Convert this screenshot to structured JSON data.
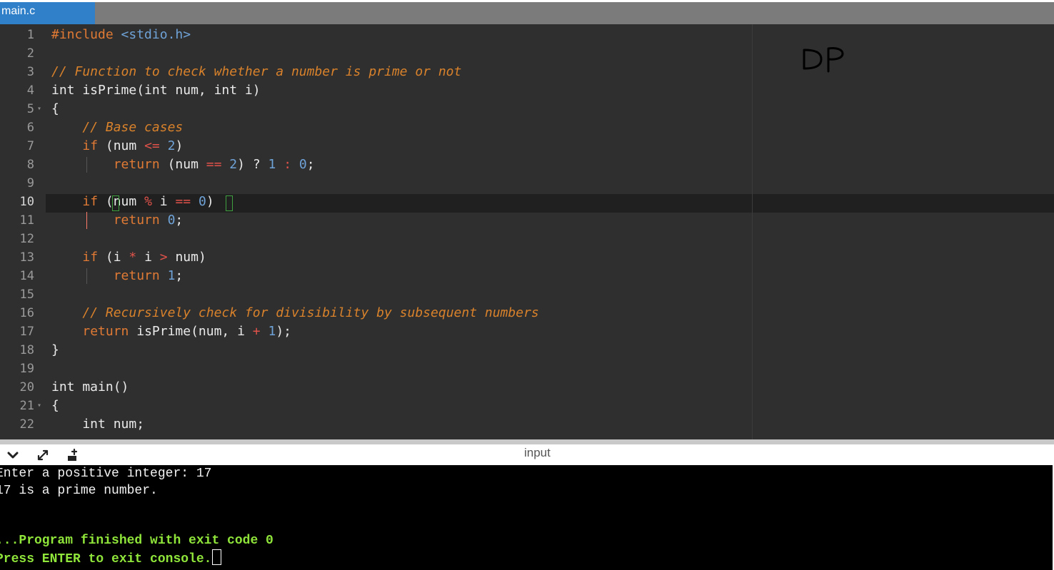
{
  "tab": {
    "title": "main.c"
  },
  "editor": {
    "lines": [
      {
        "num": "1",
        "tokens": [
          {
            "c": "kw",
            "t": "#include "
          },
          {
            "c": "inc",
            "t": "<stdio.h>"
          }
        ]
      },
      {
        "num": "2",
        "tokens": []
      },
      {
        "num": "3",
        "tokens": [
          {
            "c": "cm",
            "t": "// Function to check whether a number is prime or not"
          }
        ]
      },
      {
        "num": "4",
        "tokens": [
          {
            "c": "txt",
            "t": "int isPrime(int num, int i)"
          }
        ]
      },
      {
        "num": "5",
        "fold": true,
        "tokens": [
          {
            "c": "txt",
            "t": "{"
          }
        ]
      },
      {
        "num": "6",
        "tokens": [
          {
            "c": "txt",
            "t": "    "
          },
          {
            "c": "cm",
            "t": "// Base cases"
          }
        ]
      },
      {
        "num": "7",
        "tokens": [
          {
            "c": "txt",
            "t": "    "
          },
          {
            "c": "kw",
            "t": "if"
          },
          {
            "c": "txt",
            "t": " (num "
          },
          {
            "c": "op",
            "t": "<="
          },
          {
            "c": "txt",
            "t": " "
          },
          {
            "c": "num",
            "t": "2"
          },
          {
            "c": "txt",
            "t": ")"
          }
        ]
      },
      {
        "num": "8",
        "guide": true,
        "tokens": [
          {
            "c": "txt",
            "t": "        "
          },
          {
            "c": "kw",
            "t": "return"
          },
          {
            "c": "txt",
            "t": " (num "
          },
          {
            "c": "op",
            "t": "=="
          },
          {
            "c": "txt",
            "t": " "
          },
          {
            "c": "num",
            "t": "2"
          },
          {
            "c": "txt",
            "t": ") ? "
          },
          {
            "c": "num",
            "t": "1"
          },
          {
            "c": "txt",
            "t": " "
          },
          {
            "c": "op",
            "t": ":"
          },
          {
            "c": "txt",
            "t": " "
          },
          {
            "c": "num",
            "t": "0"
          },
          {
            "c": "txt",
            "t": ";"
          }
        ]
      },
      {
        "num": "9",
        "tokens": []
      },
      {
        "num": "10",
        "active": true,
        "tokens": [
          {
            "c": "txt",
            "t": "    "
          },
          {
            "c": "kw",
            "t": "if"
          },
          {
            "c": "txt",
            "t": " (num "
          },
          {
            "c": "op",
            "t": "%"
          },
          {
            "c": "txt",
            "t": " i "
          },
          {
            "c": "op",
            "t": "=="
          },
          {
            "c": "txt",
            "t": " "
          },
          {
            "c": "num",
            "t": "0"
          },
          {
            "c": "txt",
            "t": ")"
          }
        ]
      },
      {
        "num": "11",
        "cursor": true,
        "tokens": [
          {
            "c": "txt",
            "t": "        "
          },
          {
            "c": "kw",
            "t": "return"
          },
          {
            "c": "txt",
            "t": " "
          },
          {
            "c": "num",
            "t": "0"
          },
          {
            "c": "txt",
            "t": ";"
          }
        ]
      },
      {
        "num": "12",
        "tokens": []
      },
      {
        "num": "13",
        "tokens": [
          {
            "c": "txt",
            "t": "    "
          },
          {
            "c": "kw",
            "t": "if"
          },
          {
            "c": "txt",
            "t": " (i "
          },
          {
            "c": "op",
            "t": "*"
          },
          {
            "c": "txt",
            "t": " i "
          },
          {
            "c": "op",
            "t": ">"
          },
          {
            "c": "txt",
            "t": " num)"
          }
        ]
      },
      {
        "num": "14",
        "guide": true,
        "tokens": [
          {
            "c": "txt",
            "t": "        "
          },
          {
            "c": "kw",
            "t": "return"
          },
          {
            "c": "txt",
            "t": " "
          },
          {
            "c": "num",
            "t": "1"
          },
          {
            "c": "txt",
            "t": ";"
          }
        ]
      },
      {
        "num": "15",
        "tokens": []
      },
      {
        "num": "16",
        "tokens": [
          {
            "c": "txt",
            "t": "    "
          },
          {
            "c": "cm",
            "t": "// Recursively check for divisibility by subsequent numbers"
          }
        ]
      },
      {
        "num": "17",
        "tokens": [
          {
            "c": "txt",
            "t": "    "
          },
          {
            "c": "kw",
            "t": "return"
          },
          {
            "c": "txt",
            "t": " isPrime(num, i "
          },
          {
            "c": "op",
            "t": "+"
          },
          {
            "c": "txt",
            "t": " "
          },
          {
            "c": "num",
            "t": "1"
          },
          {
            "c": "txt",
            "t": ");"
          }
        ]
      },
      {
        "num": "18",
        "tokens": [
          {
            "c": "txt",
            "t": "}"
          }
        ]
      },
      {
        "num": "19",
        "tokens": []
      },
      {
        "num": "20",
        "tokens": [
          {
            "c": "txt",
            "t": "int main()"
          }
        ]
      },
      {
        "num": "21",
        "fold": true,
        "tokens": [
          {
            "c": "txt",
            "t": "{"
          }
        ]
      },
      {
        "num": "22",
        "tokens": [
          {
            "c": "txt",
            "t": "    int num;"
          }
        ]
      }
    ],
    "annotation_text": "DP"
  },
  "console_toolbar": {
    "icons": [
      "chevron-down-icon",
      "expand-icon",
      "stop-console-icon"
    ],
    "input_label": "input"
  },
  "console": {
    "output_lines": [
      "Enter a positive integer: 17",
      "17 is a prime number."
    ],
    "status_lines": [
      "...Program finished with exit code 0",
      "Press ENTER to exit console."
    ]
  },
  "colors": {
    "tab_active": "#2f7fc9",
    "editor_bg": "#2f2f2f",
    "keyword": "#e07a34",
    "comment": "#d9822b",
    "number": "#6fa3d8",
    "operator": "#e0524a",
    "console_green": "#8fe53a"
  }
}
